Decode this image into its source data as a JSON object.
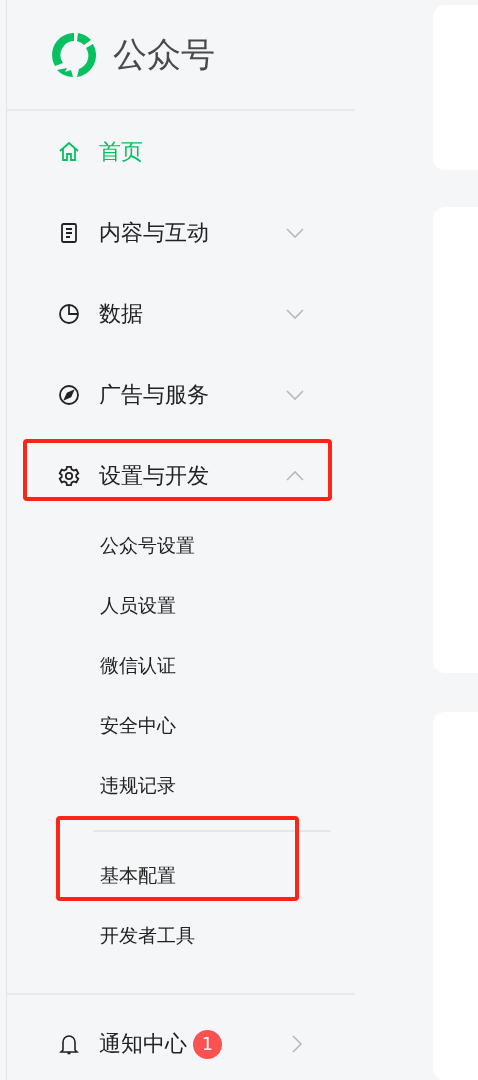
{
  "logo": {
    "title": "公众号"
  },
  "menu": [
    {
      "label": "首页",
      "selected": true,
      "highlighted": false
    },
    {
      "label": "内容与互动",
      "selected": false,
      "expanded": false,
      "highlighted": false
    },
    {
      "label": "数据",
      "selected": false,
      "expanded": false,
      "highlighted": false
    },
    {
      "label": "广告与服务",
      "selected": false,
      "expanded": false,
      "highlighted": false
    },
    {
      "label": "设置与开发",
      "selected": false,
      "expanded": true,
      "highlighted": true,
      "groups": [
        {
          "items": [
            {
              "label": "公众号设置",
              "highlighted": false
            },
            {
              "label": "人员设置",
              "highlighted": false
            },
            {
              "label": "微信认证",
              "highlighted": false
            },
            {
              "label": "安全中心",
              "highlighted": false
            },
            {
              "label": "违规记录",
              "highlighted": false
            }
          ]
        },
        {
          "items": [
            {
              "label": "基本配置",
              "highlighted": true
            },
            {
              "label": "开发者工具",
              "highlighted": false
            }
          ]
        }
      ]
    }
  ],
  "notifications": {
    "label": "通知中心",
    "badge": "1"
  }
}
